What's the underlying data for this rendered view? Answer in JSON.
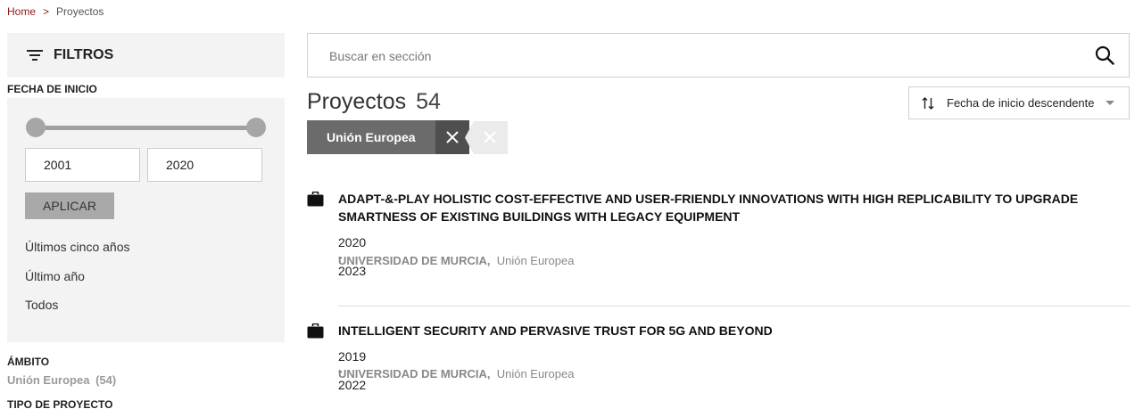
{
  "breadcrumb": {
    "home": "Home",
    "separator": ">",
    "current": "Proyectos"
  },
  "filters": {
    "header": "FILTROS",
    "date_section": {
      "label": "FECHA DE INICIO",
      "from_year": "2001",
      "to_year": "2020",
      "apply_label": "APLICAR",
      "quick_links": [
        "Últimos cinco años",
        "Último año",
        "Todos"
      ]
    },
    "ambito": {
      "label": "ÁMBITO",
      "item_label": "Unión Europea",
      "item_count": "(54)"
    },
    "tipo": {
      "label": "TIPO DE PROYECTO"
    }
  },
  "search": {
    "placeholder": "Buscar en sección",
    "value": ""
  },
  "heading": {
    "title": "Proyectos",
    "count": "54"
  },
  "sort": {
    "label": "Fecha de inicio descendente"
  },
  "active_filter": {
    "label": "Unión Europea"
  },
  "results": [
    {
      "title": "ADAPT-&-PLAY HOLISTIC COST-EFFECTIVE AND USER-FRIENDLY INNOVATIONS WITH HIGH REPLICABILITY TO UPGRADE SMARTNESS OF EXISTING BUILDINGS WITH LEGACY EQUIPMENT",
      "years": "2020 - 2023",
      "org": "UNIVERSIDAD DE MURCIA,",
      "scope": "Unión Europea"
    },
    {
      "title": "INTELLIGENT SECURITY AND PERVASIVE TRUST FOR 5G AND BEYOND",
      "years": "2019 - 2022",
      "org": "UNIVERSIDAD DE MURCIA,",
      "scope": "Unión Europea"
    }
  ],
  "colors": {
    "accent": "#8b1a1a",
    "panel": "#f3f3f3",
    "chip": "#6b6b6b",
    "chip_close": "#4f4f4f"
  }
}
